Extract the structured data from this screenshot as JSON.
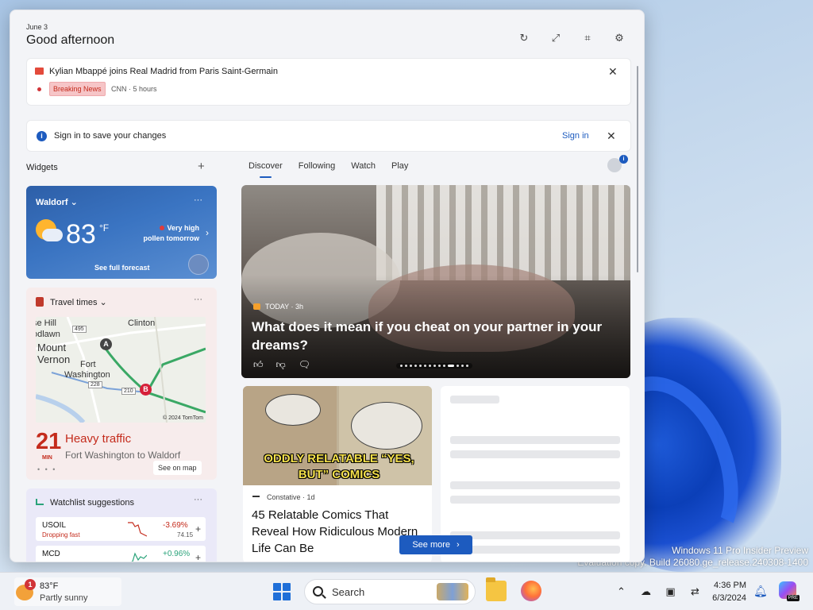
{
  "panel": {
    "date": "June 3",
    "greeting": "Good afternoon",
    "header_icons": [
      "refresh-icon",
      "expand-icon",
      "pin-icon",
      "settings-icon"
    ]
  },
  "breaking": {
    "headline": "Kylian Mbappé joins Real Madrid from Paris Saint-Germain",
    "tag": "Breaking News",
    "source": "CNN · 5 hours"
  },
  "signin": {
    "message": "Sign in to save your changes",
    "link": "Sign in"
  },
  "widgets": {
    "label": "Widgets",
    "add": "+"
  },
  "weather": {
    "location": "Waldorf",
    "temp": "83",
    "unit": "°F",
    "alert_line1": "Very high",
    "alert_line2": "pollen tomorrow",
    "forecast_link": "See full forecast"
  },
  "travel": {
    "title": "Travel times",
    "map_labels": [
      "Clinton",
      "se Hill",
      "odlawn",
      "Mount",
      "Vernon",
      "Fort",
      "Washington"
    ],
    "route_shields": [
      "495",
      "228",
      "210"
    ],
    "map_credit": "© 2024 TomTom",
    "minutes": "21",
    "min_label": "MIN",
    "status": "Heavy traffic",
    "route": "Fort Washington to Waldorf",
    "pager": "• • •",
    "see_map": "See on map"
  },
  "watchlist": {
    "title": "Watchlist suggestions",
    "items": [
      {
        "symbol": "USOIL",
        "sub": "Dropping fast",
        "change": "-3.69%",
        "price": "74.15",
        "direction": "down"
      },
      {
        "symbol": "MCD",
        "sub": "",
        "change": "+0.96%",
        "price": "",
        "direction": "up"
      }
    ]
  },
  "feed": {
    "tabs": [
      "Discover",
      "Following",
      "Watch",
      "Play"
    ],
    "active_tab": "Discover",
    "hero": {
      "source": "TODAY · 3h",
      "headline": "What does it mean if you cheat on your partner in your dreams?"
    },
    "card": {
      "caption": "ODDLY RELATABLE “YES, BUT” COMICS",
      "publisher": "Constative · 1d",
      "title": "45 Relatable Comics That Reveal How Ridiculous Modern Life Can Be"
    },
    "see_more": "See more"
  },
  "desktop": {
    "watermark_line1": "Windows 11 Pro Insider Preview",
    "watermark_line2": "Evaluation copy. Build 26080.ge_release.240308-1400"
  },
  "taskbar": {
    "weather_temp": "83°F",
    "weather_desc": "Partly sunny",
    "weather_badge": "1",
    "search_placeholder": "Search",
    "time": "4:36 PM",
    "date": "6/3/2024",
    "copilot_badge": "PRE",
    "tray_icons": [
      "chevron-up-icon",
      "network-off-icon",
      "display-icon",
      "sync-icon"
    ]
  },
  "colors": {
    "accent": "#1d5bbf",
    "alert_red": "#c42b1c",
    "up_green": "#2aa37a"
  }
}
